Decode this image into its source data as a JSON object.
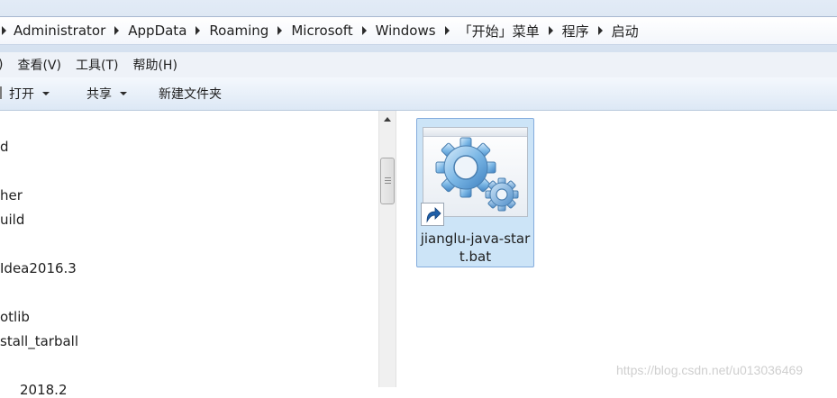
{
  "address_bar": {
    "breadcrumbs": [
      "Administrator",
      "AppData",
      "Roaming",
      "Microsoft",
      "Windows",
      "「开始」菜单",
      "程序",
      "启动"
    ]
  },
  "menu_bar": {
    "items": [
      "查看(V)",
      "工具(T)",
      "帮助(H)"
    ],
    "partial_first": ")"
  },
  "command_bar": {
    "open_label": "打开",
    "share_label": "共享",
    "new_folder_label": "新建文件夹"
  },
  "nav_pane": {
    "items": [
      "d",
      "her",
      "uild",
      "Idea2016.3",
      "otlib",
      "stall_tarball",
      "2018.2"
    ]
  },
  "files": [
    {
      "name_line1": "jianglu-java-star",
      "name_line2": "t.bat",
      "icon": "batch-file-gears-icon",
      "selected": true
    }
  ],
  "watermark": "https://blog.csdn.net/u013036469",
  "colors": {
    "selection_fill": "#cce4f7",
    "selection_border": "#84acdd",
    "toolbar_gradient_bottom": "#dde8f5"
  }
}
